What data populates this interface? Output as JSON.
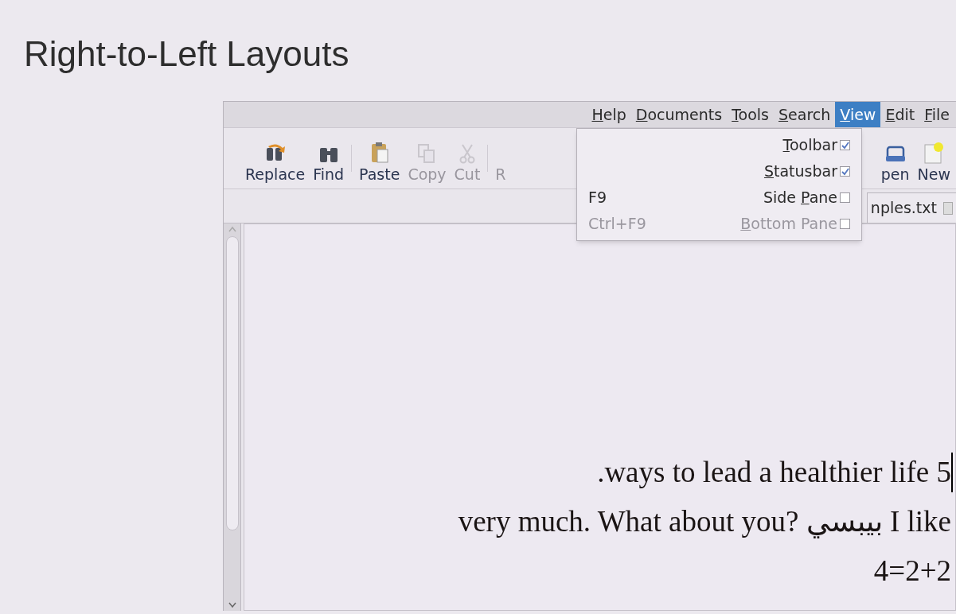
{
  "slide": {
    "title": "Right-to-Left Layouts"
  },
  "menubar": [
    {
      "access_key": "H",
      "label_rest": "elp",
      "selected": false
    },
    {
      "access_key": "D",
      "label_rest": "ocuments",
      "selected": false
    },
    {
      "access_key": "T",
      "label_rest": "ools",
      "selected": false
    },
    {
      "access_key": "S",
      "label_rest": "earch",
      "selected": false
    },
    {
      "access_key": "V",
      "label_rest": "iew",
      "selected": true
    },
    {
      "access_key": "E",
      "label_rest": "dit",
      "selected": false
    },
    {
      "access_key": "F",
      "label_rest": "ile",
      "selected": false
    }
  ],
  "toolbar_left": [
    {
      "kind": "replace",
      "label": "Replace",
      "disabled": false
    },
    {
      "kind": "find",
      "label": "Find",
      "disabled": false
    },
    {
      "kind": "separator"
    },
    {
      "kind": "paste",
      "label": "Paste",
      "disabled": false
    },
    {
      "kind": "copy",
      "label": "Copy",
      "disabled": true
    },
    {
      "kind": "cut",
      "label": "Cut",
      "disabled": true
    },
    {
      "kind": "separator"
    },
    {
      "kind": "partial",
      "label": "R",
      "disabled": true
    }
  ],
  "toolbar_right": [
    {
      "kind": "open",
      "label": "pen",
      "disabled": false
    },
    {
      "kind": "new",
      "label": "New",
      "disabled": false
    }
  ],
  "tab": {
    "label": "nples.txt"
  },
  "view_menu": [
    {
      "access_key": "T",
      "label_rest": "oolbar",
      "checked": true,
      "disabled": false
    },
    {
      "access_key": "S",
      "label_rest": "tatusbar",
      "checked": true,
      "disabled": false
    },
    {
      "label_start": "Side ",
      "access_key": "P",
      "label_rest": "ane",
      "shortcut": "F9",
      "checked": false,
      "disabled": false
    },
    {
      "access_key": "B",
      "label_rest": "ottom Pane",
      "shortcut": "Ctrl+F9",
      "checked": false,
      "disabled": true
    }
  ],
  "document": {
    "lines": [
      {
        "text": ".ways to lead a healthier life 5",
        "caret": true
      },
      {
        "text": "very much. What about you? بيبسي I like",
        "caret": false
      },
      {
        "text": "4=2+2",
        "caret": false
      }
    ]
  }
}
